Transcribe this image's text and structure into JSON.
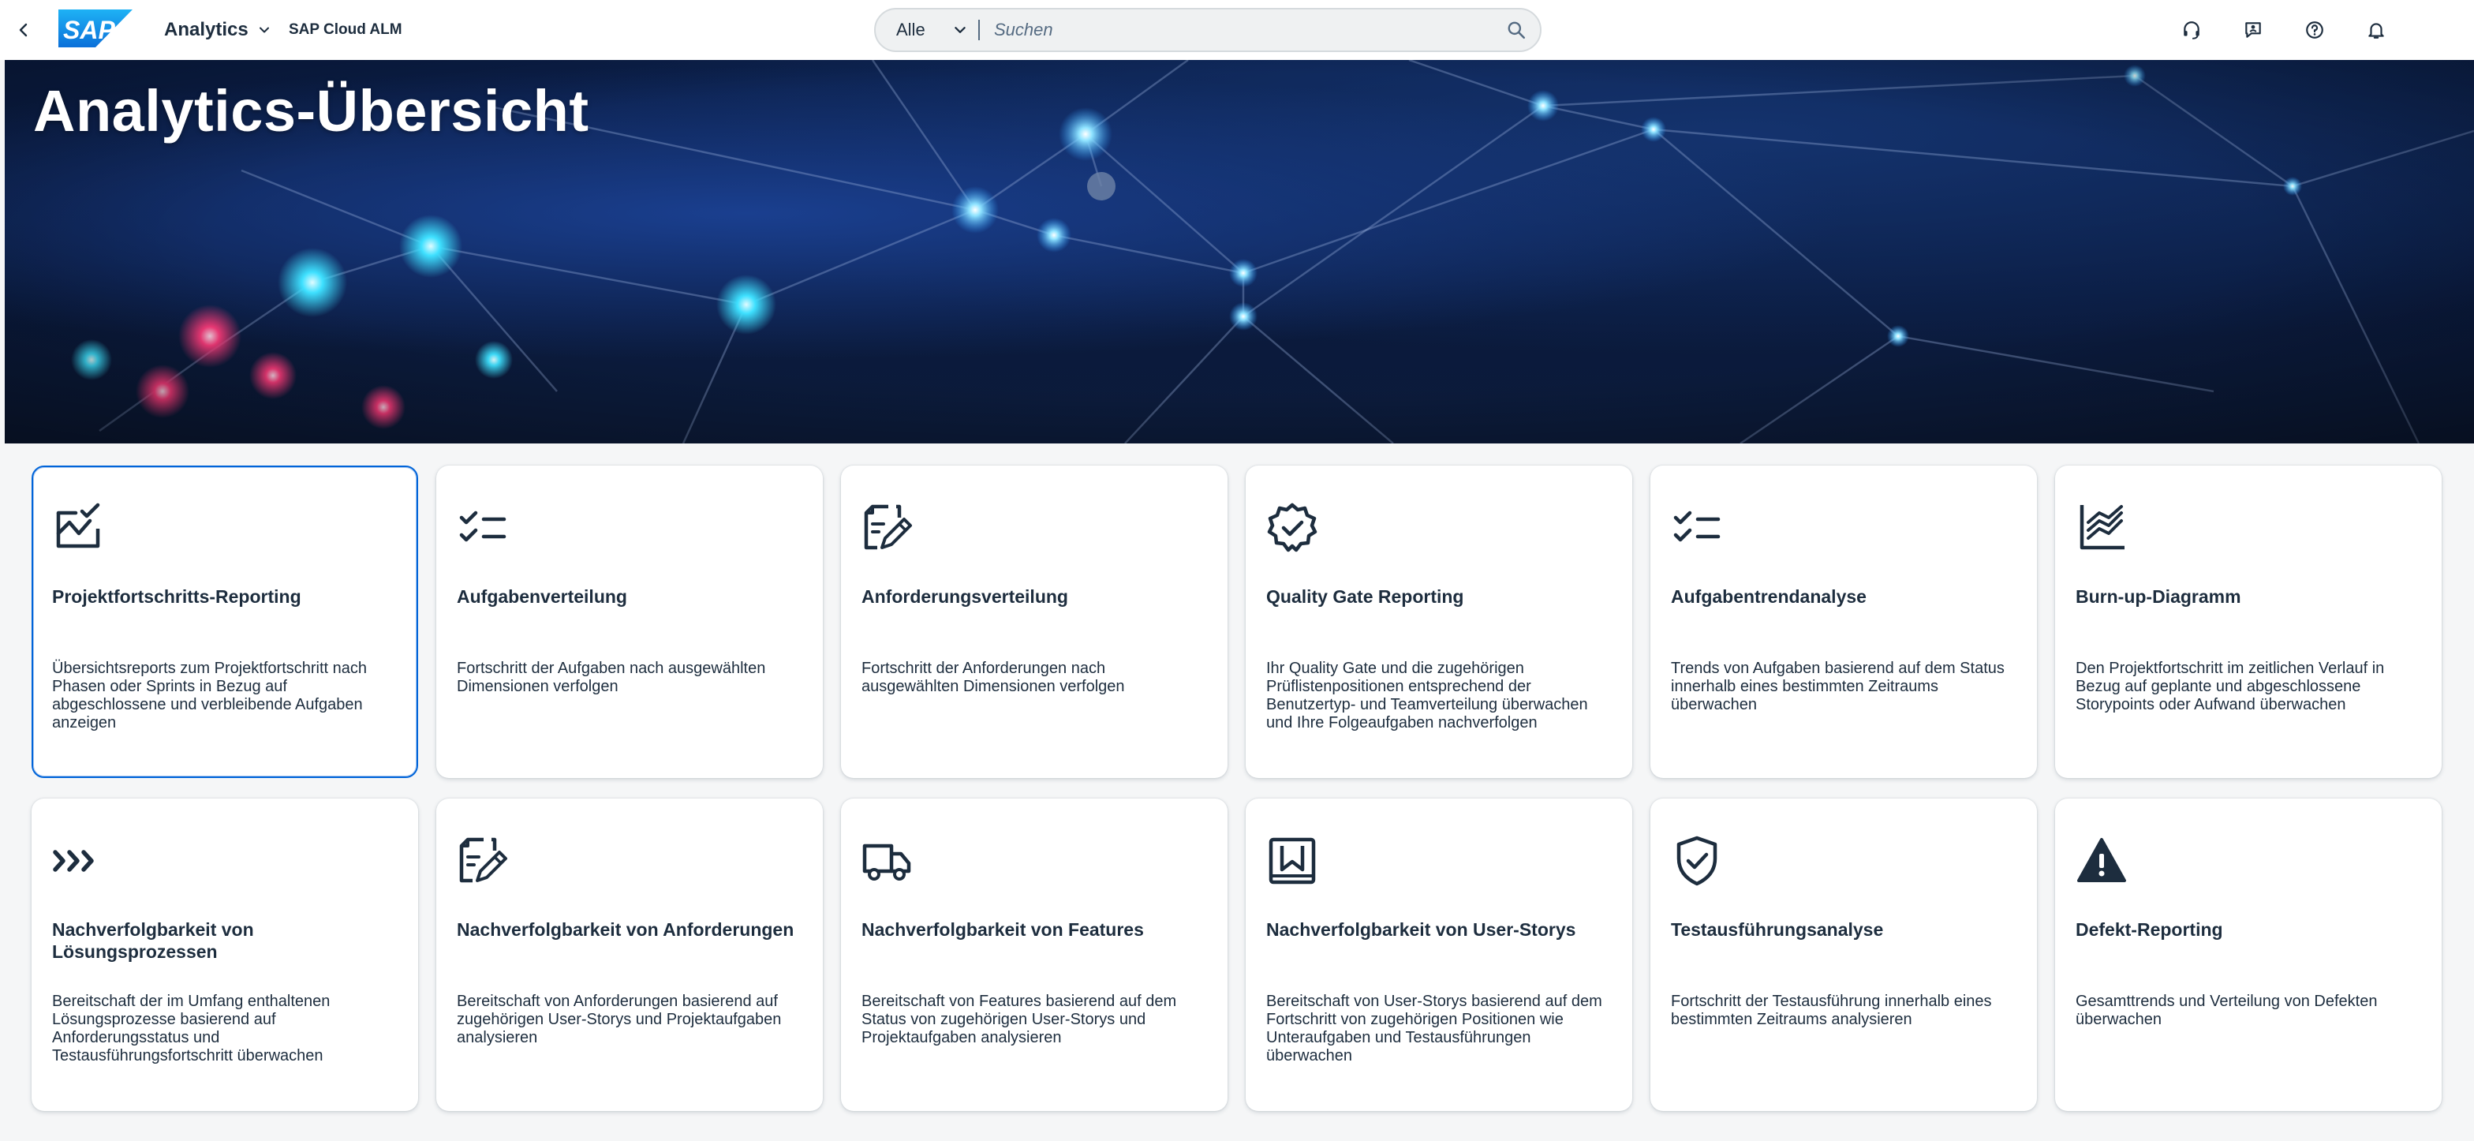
{
  "shell": {
    "app_title": "Analytics",
    "app_subtitle": "SAP Cloud ALM",
    "logo_text": "SAP",
    "search": {
      "scope": "Alle",
      "placeholder": "Suchen"
    },
    "actions": [
      {
        "icon": "headset-icon"
      },
      {
        "icon": "feedback-icon"
      },
      {
        "icon": "help-icon"
      },
      {
        "icon": "bell-icon"
      }
    ]
  },
  "hero": {
    "title": "Analytics-Übersicht"
  },
  "tiles": [
    {
      "icon": "progress-chart-icon",
      "title": "Projektfortschritts-Reporting",
      "description": "Übersichtsreports zum Projektfortschritt nach Phasen oder Sprints in Bezug auf abgeschlossene und verbleibende Aufgaben anzeigen"
    },
    {
      "icon": "task-list-icon",
      "title": "Aufgabenverteilung",
      "description": "Fortschritt der Aufgaben nach ausgewählten Dimensionen verfolgen"
    },
    {
      "icon": "requirement-edit-icon",
      "title": "Anforderungsverteilung",
      "description": "Fortschritt der Anforderungen nach ausgewählten Dimensionen verfolgen"
    },
    {
      "icon": "quality-badge-icon",
      "title": "Quality Gate Reporting",
      "description": "Ihr Quality Gate und die zugehörigen Prüflistenpositionen entsprechend der Benutzertyp- und Teamverteilung überwachen und Ihre Folgeaufgaben nachverfolgen"
    },
    {
      "icon": "task-list-icon",
      "title": "Aufgabentrendanalyse",
      "description": "Trends von Aufgaben basierend auf dem Status innerhalb eines bestimmten Zeitraums überwachen"
    },
    {
      "icon": "burnup-chart-icon",
      "title": "Burn-up-Diagramm",
      "description": "Den Projektfortschritt im zeitlichen Verlauf in Bezug auf geplante und abgeschlossene Storypoints oder Aufwand überwachen"
    },
    {
      "icon": "process-chevrons-icon",
      "title": "Nachverfolgbarkeit von Lösungsprozessen",
      "description": "Bereitschaft der im Umfang enthaltenen Lösungsprozesse basierend auf Anforderungsstatus und Testausführungsfortschritt überwachen"
    },
    {
      "icon": "requirement-edit-icon",
      "title": "Nachverfolgbarkeit von Anforderungen",
      "description": "Bereitschaft von Anforderungen basierend auf zugehörigen User-Storys und Projektaufgaben analysieren"
    },
    {
      "icon": "delivery-truck-icon",
      "title": "Nachverfolgbarkeit von Features",
      "description": "Bereitschaft von Features basierend auf dem Status von zugehörigen User-Storys und Projektaufgaben analysieren"
    },
    {
      "icon": "bookmark-frame-icon",
      "title": "Nachverfolgbarkeit von User-Storys",
      "description": "Bereitschaft von User-Storys basierend auf dem Fortschritt von zugehörigen Positionen wie Unteraufgaben und Testausführungen überwachen"
    },
    {
      "icon": "shield-check-icon",
      "title": "Testausführungsanalyse",
      "description": "Fortschritt der Testausführung innerhalb eines bestimmten Zeitraums analysieren"
    },
    {
      "icon": "warning-triangle-icon",
      "title": "Defekt-Reporting",
      "description": "Gesamttrends und Verteilung von Defekten überwachen"
    }
  ]
}
